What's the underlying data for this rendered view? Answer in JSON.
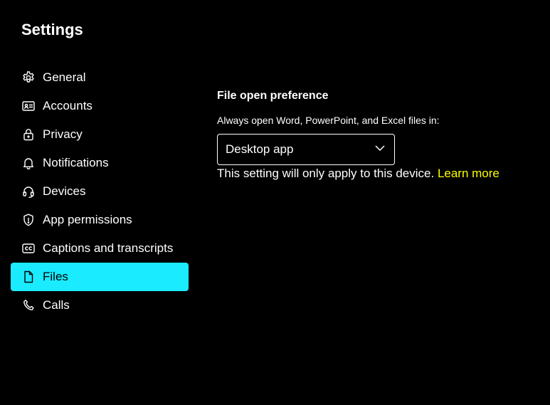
{
  "window": {
    "title": "Settings"
  },
  "sidebar": {
    "items": [
      {
        "label": "General",
        "icon": "gear-icon"
      },
      {
        "label": "Accounts",
        "icon": "id-card-icon"
      },
      {
        "label": "Privacy",
        "icon": "lock-icon"
      },
      {
        "label": "Notifications",
        "icon": "bell-icon"
      },
      {
        "label": "Devices",
        "icon": "headset-icon"
      },
      {
        "label": "App permissions",
        "icon": "shield-icon"
      },
      {
        "label": "Captions and transcripts",
        "icon": "closed-captions-icon"
      },
      {
        "label": "Files",
        "icon": "document-icon",
        "active": true
      },
      {
        "label": "Calls",
        "icon": "phone-icon"
      }
    ]
  },
  "main": {
    "heading": "File open preference",
    "field_label": "Always open Word, PowerPoint, and Excel files in:",
    "dropdown": {
      "selected": "Desktop app"
    },
    "helper_text": "This setting will only apply to this device.",
    "learn_more": "Learn more"
  },
  "colors": {
    "background": "#000000",
    "text": "#ffffff",
    "active_highlight": "#1aebff",
    "link": "#ffff00"
  }
}
